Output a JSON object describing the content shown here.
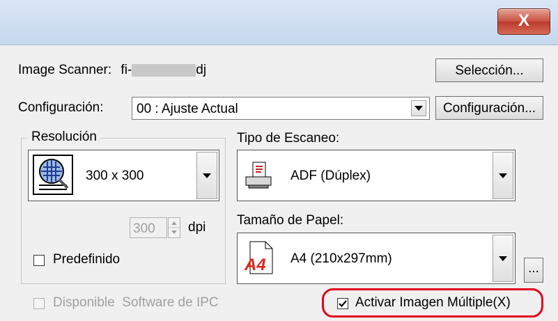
{
  "window": {
    "close_label": "X"
  },
  "scanner": {
    "label": "Image Scanner:",
    "model_prefix": "fi-",
    "model_suffix": "dj",
    "select_button": "Selección..."
  },
  "config": {
    "label": "Configuración:",
    "value": "00 : Ajuste Actual",
    "button": "Configuración..."
  },
  "resolution": {
    "group_label": "Resolución",
    "value": "300 x 300",
    "dpi_value": "300",
    "dpi_unit": "dpi",
    "predefined_label": "Predefinido"
  },
  "scan_type": {
    "label": "Tipo de Escaneo:",
    "value": "ADF (Dúplex)"
  },
  "paper_size": {
    "label": "Tamaño de Papel:",
    "icon_text": "A4",
    "value": "A4 (210x297mm)",
    "more_button": "..."
  },
  "bottom": {
    "ipc_label": "Disponible  Software de IPC",
    "multi_image_label": "Activar Imagen Múltiple(X)",
    "multi_image_checked": true,
    "highlight_color": "#e0001b"
  },
  "colors": {
    "title_bar": "#c5d8ee",
    "close_red": "#c75040",
    "dialog_bg": "#f0f0f0"
  }
}
